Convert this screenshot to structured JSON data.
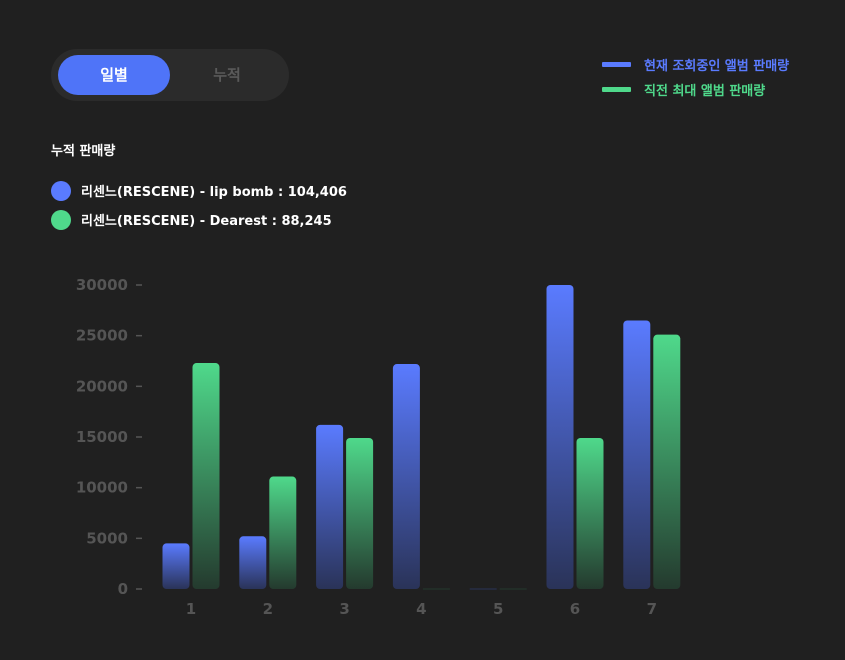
{
  "toggle": {
    "options": [
      {
        "label": "일별",
        "active": true
      },
      {
        "label": "누적",
        "active": false
      }
    ]
  },
  "legend": [
    {
      "label": "현재 조회중인 앨범 판매량",
      "color": "#5a7bff"
    },
    {
      "label": "직전 최대 앨범 판매량",
      "color": "#4fd98b"
    }
  ],
  "cumulative": {
    "title": "누적 판매량",
    "items": [
      {
        "label": "리센느(RESCENE) - lip bomb : 104,406",
        "color": "#5a7bff"
      },
      {
        "label": "리센느(RESCENE) - Dearest : 88,245",
        "color": "#4fd98b"
      }
    ]
  },
  "chart_data": {
    "type": "bar",
    "categories": [
      "1",
      "2",
      "3",
      "4",
      "5",
      "6",
      "7"
    ],
    "series": [
      {
        "values": [
          4500,
          5200,
          16200,
          22200,
          0,
          30000,
          26500
        ],
        "color": "#5a7bff"
      },
      {
        "values": [
          22300,
          11100,
          14900,
          0,
          0,
          14900,
          25100
        ],
        "color": "#4fd98b"
      }
    ],
    "ylim": [
      0,
      30000
    ],
    "yticks": [
      0,
      5000,
      10000,
      15000,
      20000,
      25000,
      30000
    ],
    "ytick_labels": [
      "0",
      "5000",
      "10000",
      "15000",
      "20000",
      "25000",
      "30000"
    ],
    "grid": false
  }
}
